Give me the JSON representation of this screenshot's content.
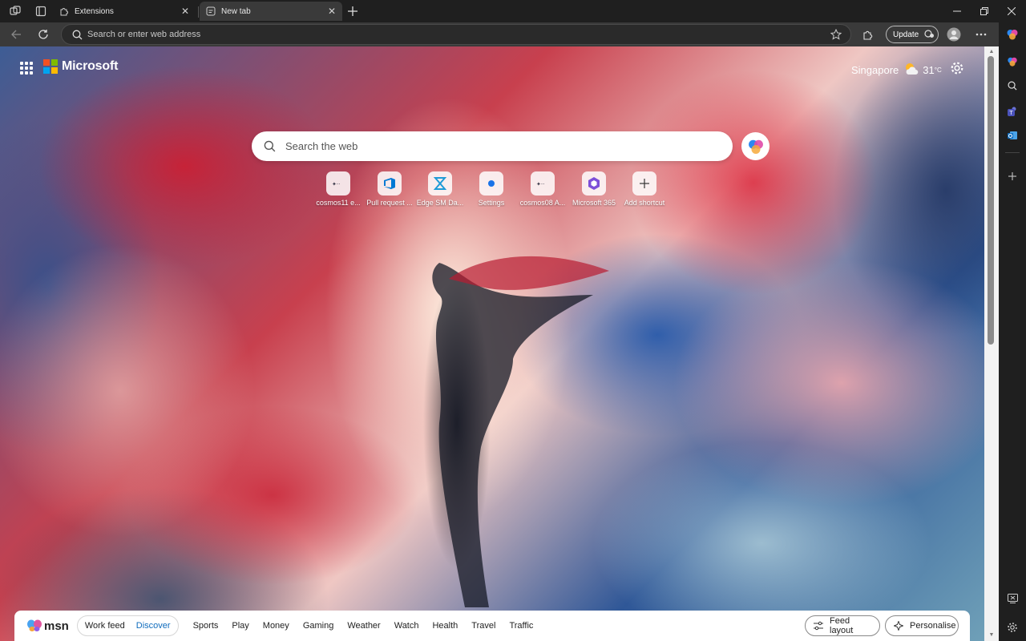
{
  "browser": {
    "tabs": [
      {
        "title": "Extensions",
        "active": false
      },
      {
        "title": "New tab",
        "active": true
      }
    ],
    "window_controls": {
      "minimize": "—",
      "restore": "❐",
      "close": "✕"
    }
  },
  "toolbar": {
    "omnibox_placeholder": "Search or enter web address",
    "update_label": "Update"
  },
  "page": {
    "brand": "Microsoft",
    "weather": {
      "city": "Singapore",
      "temp": "31",
      "unit": "°C"
    },
    "search_placeholder": "Search the web",
    "shortcuts": [
      {
        "label": "cosmos11 e...",
        "icon": "cosmos-icon"
      },
      {
        "label": "Pull request ...",
        "icon": "azure-devops-icon"
      },
      {
        "label": "Edge SM Da...",
        "icon": "dashboard-icon"
      },
      {
        "label": "Settings",
        "icon": "edge-settings-icon"
      },
      {
        "label": "cosmos08 A...",
        "icon": "cosmos-icon"
      },
      {
        "label": "Microsoft 365",
        "icon": "m365-icon"
      },
      {
        "label": "Add shortcut",
        "icon": "plus-icon"
      }
    ]
  },
  "msn": {
    "logo_text": "msn",
    "feed_tabs": [
      "Work feed",
      "Discover"
    ],
    "active_feed": "Discover",
    "nav": [
      "Sports",
      "Play",
      "Money",
      "Gaming",
      "Weather",
      "Watch",
      "Health",
      "Travel",
      "Traffic"
    ],
    "feed_layout_label": "Feed layout",
    "personalise_label": "Personalise"
  },
  "colors": {
    "accent": "#0f6cbd",
    "ms_red": "#f25022",
    "ms_green": "#7fba00",
    "ms_blue": "#00a4ef",
    "ms_yellow": "#ffb900"
  }
}
